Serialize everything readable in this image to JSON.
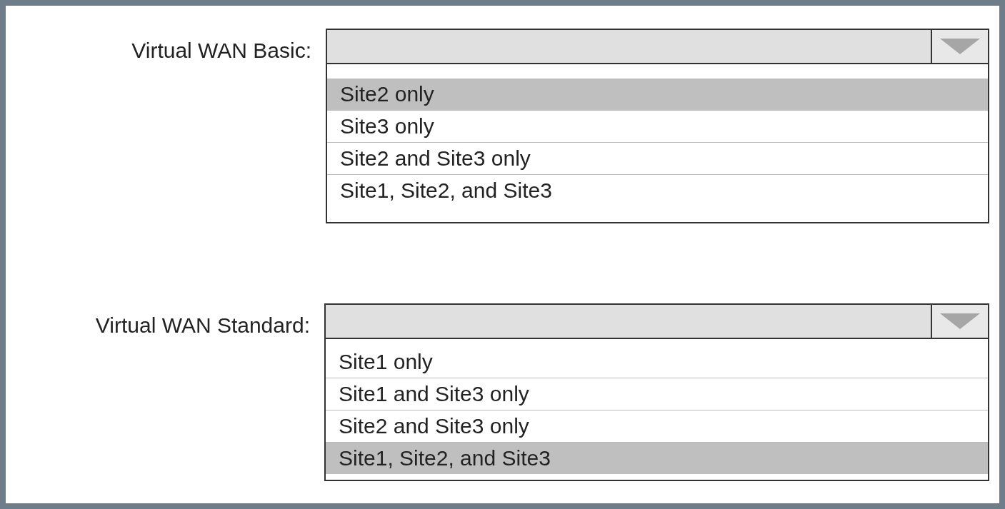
{
  "dropdowns": [
    {
      "label": "Virtual WAN Basic:",
      "options": [
        {
          "text": "Site2 only",
          "selected": true
        },
        {
          "text": "Site3 only",
          "selected": false
        },
        {
          "text": "Site2 and Site3 only",
          "selected": false
        },
        {
          "text": "Site1, Site2, and Site3",
          "selected": false
        }
      ]
    },
    {
      "label": "Virtual WAN Standard:",
      "options": [
        {
          "text": "Site1 only",
          "selected": false
        },
        {
          "text": "Site1 and Site3 only",
          "selected": false
        },
        {
          "text": "Site2 and Site3 only",
          "selected": false
        },
        {
          "text": "Site1, Site2, and Site3",
          "selected": true
        }
      ]
    }
  ]
}
